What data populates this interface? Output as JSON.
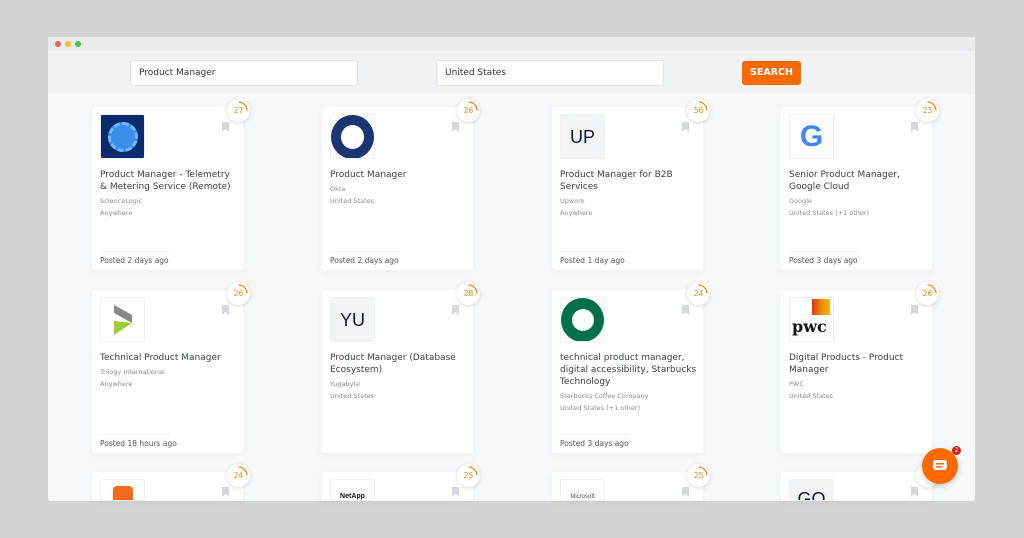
{
  "search": {
    "query": "Product Manager",
    "location": "United States",
    "button": "SEARCH"
  },
  "colors": {
    "accent": "#ff6a00"
  },
  "jobs": [
    {
      "score": "27",
      "logo": "sciencelogic",
      "title": "Product Manager - Telemetry & Metering Service (Remote)",
      "company": "ScienceLogic",
      "location": "Anywhere",
      "posted": "Posted 2 days ago"
    },
    {
      "score": "26",
      "logo": "okta",
      "title": "Product Manager",
      "company": "Okta",
      "location": "United States",
      "posted": "Posted 2 days ago"
    },
    {
      "score": "56",
      "logo": "text",
      "logo_text": "UP",
      "title": "Product Manager for B2B Services",
      "company": "Upwork",
      "location": "Anywhere",
      "posted": "Posted 1 day ago"
    },
    {
      "score": "23",
      "logo": "google",
      "title": "Senior Product Manager, Google Cloud",
      "company": "Google",
      "location": "United States (+1 other)",
      "posted": "Posted 3 days ago"
    },
    {
      "score": "26",
      "logo": "trilogy",
      "title": "Technical Product Manager",
      "company": "Trilogy International",
      "location": "Anywhere",
      "posted": "Posted 18 hours ago"
    },
    {
      "score": "28",
      "logo": "text",
      "logo_text": "YU",
      "title": "Product Manager (Database Ecosystem)",
      "company": "Yugabyte",
      "location": "United States",
      "posted": ""
    },
    {
      "score": "24",
      "logo": "starbucks",
      "title": "technical product manager, digital accessibility, Starbucks Technology",
      "company": "Starbucks Coffee Company",
      "location": "United States (+1 other)",
      "posted": "Posted 3 days ago"
    },
    {
      "score": "26",
      "logo": "pwc",
      "title": "Digital Products - Product Manager",
      "company": "PWC",
      "location": "United States",
      "posted": ""
    },
    {
      "score": "24",
      "logo": "orange"
    },
    {
      "score": "25",
      "logo": "netapp"
    },
    {
      "score": "25",
      "logo": "microsoft"
    },
    {
      "score": "",
      "logo": "text",
      "logo_text": "GO"
    }
  ],
  "chat": {
    "badge": "2"
  }
}
